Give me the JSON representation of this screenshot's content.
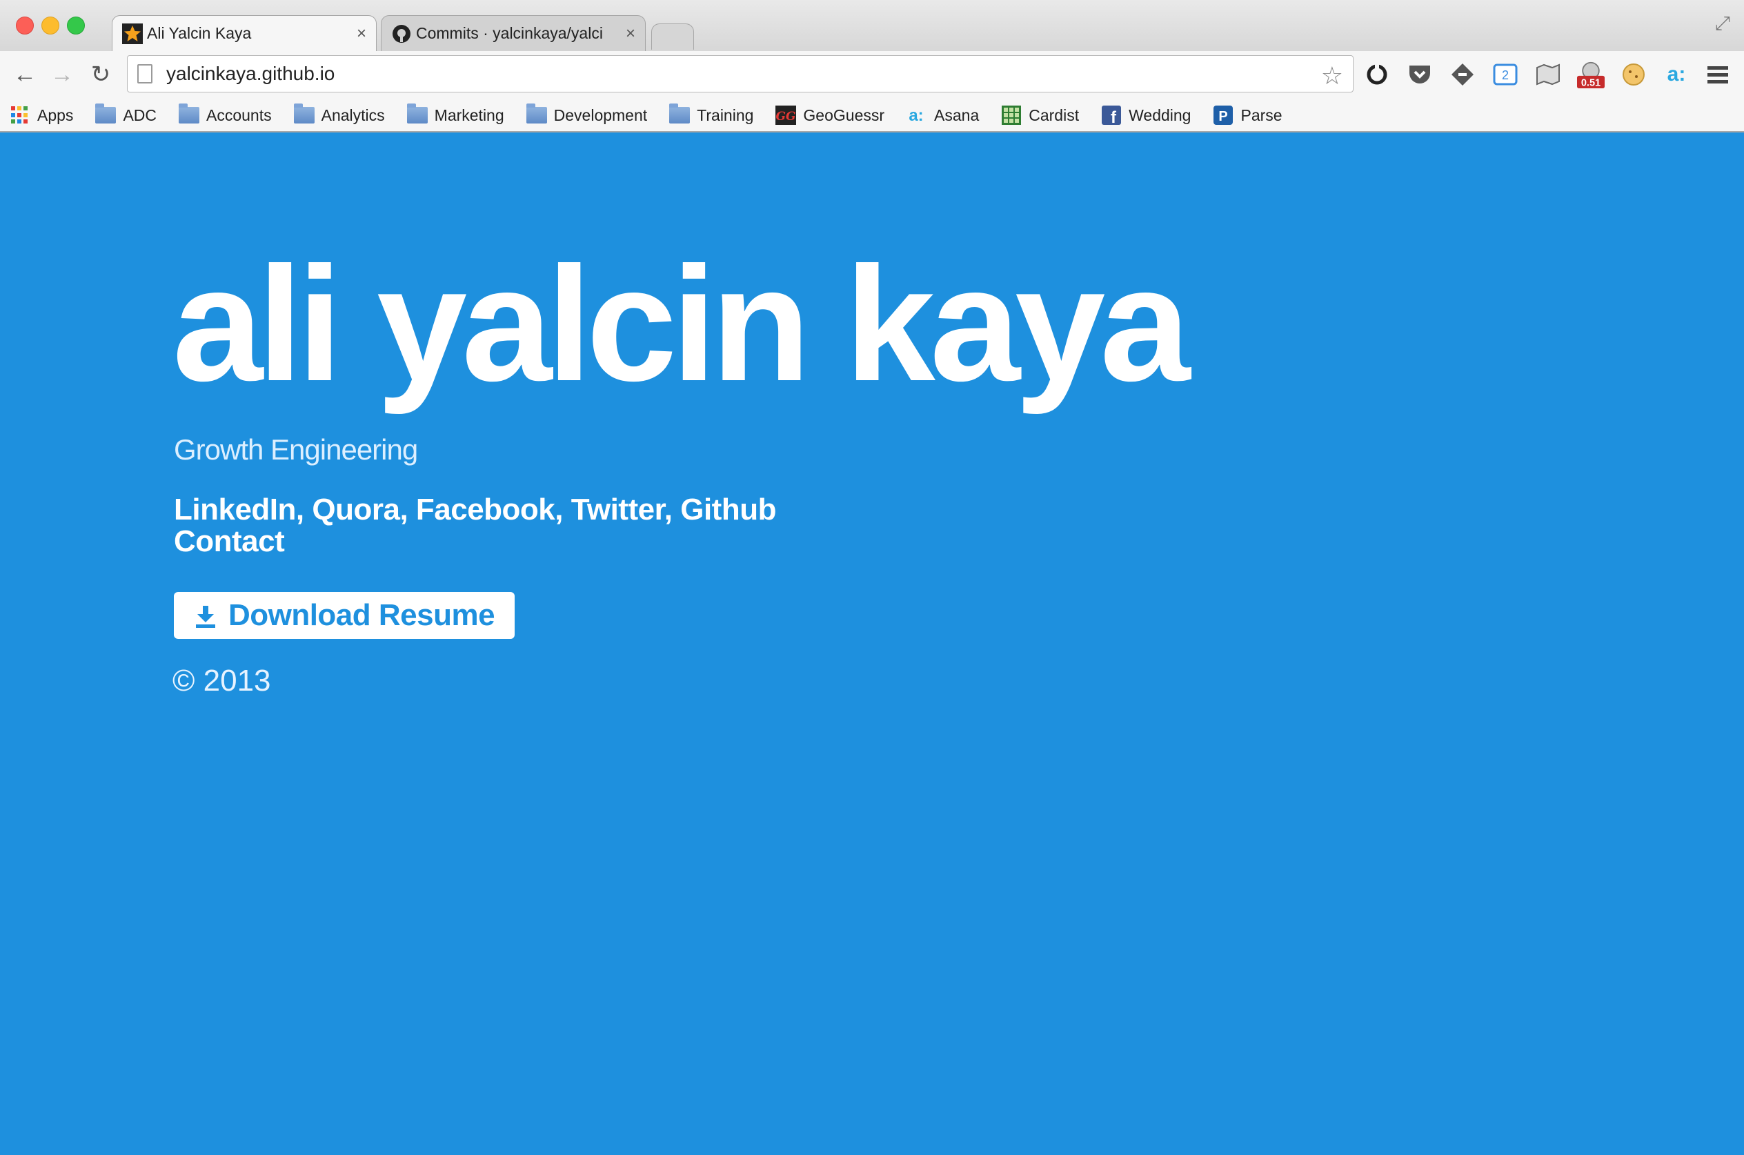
{
  "browser": {
    "tabs": [
      {
        "title": "Ali Yalcin Kaya",
        "close": "×",
        "active": true
      },
      {
        "title": "Commits · yalcinkaya/yalci",
        "close": "×",
        "active": false
      }
    ],
    "url": "yalcinkaya.github.io",
    "extensions": [
      {
        "icon": "sync-icon"
      },
      {
        "icon": "pocket-icon"
      },
      {
        "icon": "feedly-icon"
      },
      {
        "icon": "buffer-icon"
      },
      {
        "icon": "map-icon"
      },
      {
        "icon": "page-speed-icon",
        "badge": "0.51"
      },
      {
        "icon": "cookie-icon"
      },
      {
        "icon": "asana-icon",
        "glyph": "a:"
      }
    ],
    "menu_icon": "menu-icon"
  },
  "bookmarks": [
    {
      "label": "Apps",
      "icon": "apps-icon"
    },
    {
      "label": "ADC",
      "icon": "folder-icon"
    },
    {
      "label": "Accounts",
      "icon": "folder-icon"
    },
    {
      "label": "Analytics",
      "icon": "folder-icon"
    },
    {
      "label": "Marketing",
      "icon": "folder-icon"
    },
    {
      "label": "Development",
      "icon": "folder-icon"
    },
    {
      "label": "Training",
      "icon": "folder-icon"
    },
    {
      "label": "GeoGuessr",
      "icon": "geoguessr-icon"
    },
    {
      "label": "Asana",
      "icon": "asana-icon"
    },
    {
      "label": "Cardist",
      "icon": "cardist-icon"
    },
    {
      "label": "Wedding",
      "icon": "facebook-icon"
    },
    {
      "label": "Parse",
      "icon": "parse-icon"
    }
  ],
  "page": {
    "name": "ali yalcin kaya",
    "subtitle": "Growth Engineering",
    "links": [
      "LinkedIn",
      "Quora",
      "Facebook",
      "Twitter",
      "Github"
    ],
    "contact": "Contact",
    "download_label": "Download Resume",
    "copyright": "© 2013",
    "colors": {
      "background": "#1e90de",
      "text": "#ffffff"
    }
  }
}
